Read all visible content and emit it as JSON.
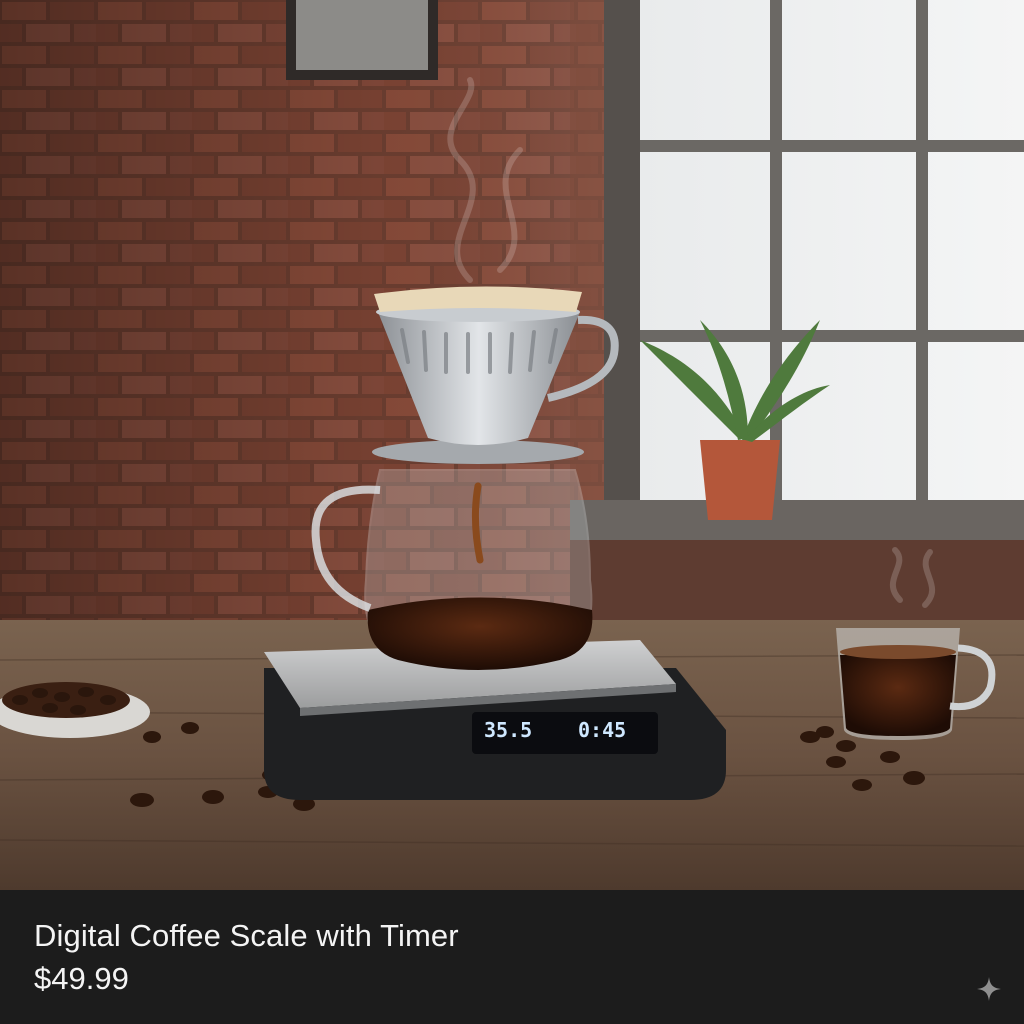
{
  "product": {
    "title": "Digital Coffee Scale with Timer",
    "price": "$49.99"
  },
  "scale_display": {
    "weight": "35.5",
    "time": "0:45"
  },
  "icons": {
    "sparkle": "sparkle-icon"
  },
  "colors": {
    "caption_bg": "#1c1c1c",
    "caption_text": "#f4f4f4",
    "display_text": "#cfe8ff"
  }
}
